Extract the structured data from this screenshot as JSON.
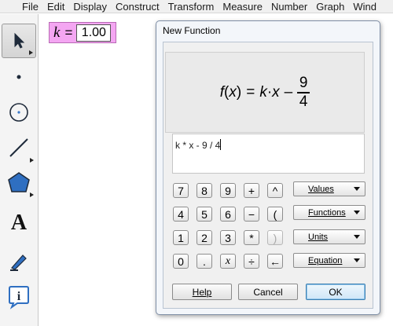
{
  "menubar": {
    "items": [
      "File",
      "Edit",
      "Display",
      "Construct",
      "Transform",
      "Measure",
      "Number",
      "Graph",
      "Wind"
    ]
  },
  "toolbox": {
    "tools": [
      {
        "name": "arrow-tool-icon",
        "selected": true
      },
      {
        "name": "point-tool-icon"
      },
      {
        "name": "compass-tool-icon"
      },
      {
        "name": "straightedge-tool-icon"
      },
      {
        "name": "polygon-tool-icon"
      },
      {
        "name": "text-tool-icon",
        "glyph": "A"
      },
      {
        "name": "marker-tool-icon"
      },
      {
        "name": "information-tool-icon",
        "glyph": "i"
      }
    ]
  },
  "parameter": {
    "name": "k",
    "equals": "=",
    "value": "1.00",
    "color": "#f4a6f2"
  },
  "dialog": {
    "title": "New Function",
    "formula": {
      "lhs_fn": "f",
      "lhs_open": "(",
      "lhs_var": "x",
      "lhs_close": ")",
      "equals": "=",
      "term_k": "k",
      "dot": "·",
      "term_x": "x",
      "minus": "–",
      "numerator": "9",
      "denominator": "4"
    },
    "input_text": "k * x - 9 / 4",
    "keypad": [
      [
        "7",
        "8",
        "9",
        "+",
        "^"
      ],
      [
        "4",
        "5",
        "6",
        "−",
        "("
      ],
      [
        "1",
        "2",
        "3",
        "*",
        ")"
      ],
      [
        "0",
        ".",
        "x",
        "÷",
        "←"
      ]
    ],
    "menu_buttons": [
      "Values",
      "Functions",
      "Units",
      "Equation"
    ],
    "buttons": {
      "help": "Help",
      "cancel": "Cancel",
      "ok": "OK"
    }
  }
}
